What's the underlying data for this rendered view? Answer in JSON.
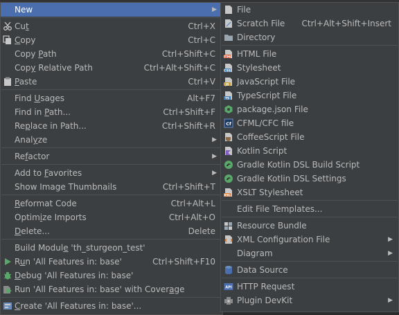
{
  "main_menu": [
    {
      "label": "New",
      "has_submenu": true,
      "selected": true
    },
    {
      "sep": true
    },
    {
      "label": "Cut",
      "shortcut": "Ctrl+X",
      "icon": "scissors-icon",
      "u": 2
    },
    {
      "label": "Copy",
      "shortcut": "Ctrl+C",
      "icon": "copy-icon",
      "u": 0
    },
    {
      "label": "Copy Path",
      "shortcut": "Ctrl+Shift+C",
      "u": 5
    },
    {
      "label": "Copy Relative Path",
      "shortcut": "Ctrl+Alt+Shift+C",
      "u": 3
    },
    {
      "label": "Paste",
      "shortcut": "Ctrl+V",
      "icon": "paste-icon",
      "u": 0
    },
    {
      "sep": true
    },
    {
      "label": "Find Usages",
      "shortcut": "Alt+F7",
      "u": 5
    },
    {
      "label": "Find in Path...",
      "shortcut": "Ctrl+Shift+F",
      "u": 8
    },
    {
      "label": "Replace in Path...",
      "shortcut": "Ctrl+Shift+R",
      "u": 2
    },
    {
      "label": "Analyze",
      "has_submenu": true,
      "u": 4
    },
    {
      "sep": true
    },
    {
      "label": "Refactor",
      "has_submenu": true,
      "u": 2
    },
    {
      "sep": true
    },
    {
      "label": "Add to Favorites",
      "has_submenu": true,
      "u": 7
    },
    {
      "label": "Show Image Thumbnails",
      "shortcut": "Ctrl+Shift+T"
    },
    {
      "sep": true
    },
    {
      "label": "Reformat Code",
      "shortcut": "Ctrl+Alt+L",
      "u": 0
    },
    {
      "label": "Optimize Imports",
      "shortcut": "Ctrl+Alt+O",
      "u": 5
    },
    {
      "label": "Delete...",
      "shortcut": "Delete",
      "u": 0
    },
    {
      "sep": true
    },
    {
      "label": "Build Module 'th_sturgeon_test'",
      "u": 11
    },
    {
      "label": "Run 'All Features in: base'",
      "shortcut": "Ctrl+Shift+F10",
      "icon": "run-icon",
      "u": 1
    },
    {
      "label": "Debug 'All Features in: base'",
      "icon": "debug-icon",
      "u": 0
    },
    {
      "label": "Run 'All Features in: base' with Coverage",
      "icon": "coverage-icon",
      "u": 38
    },
    {
      "sep": true
    },
    {
      "label": "Create 'All Features in: base'...",
      "icon": "create-config-icon",
      "u": 0
    }
  ],
  "sub_menu": [
    {
      "label": "File",
      "icon": "file-icon"
    },
    {
      "label": "Scratch File",
      "shortcut": "Ctrl+Alt+Shift+Insert",
      "icon": "scratch-file-icon"
    },
    {
      "label": "Directory",
      "icon": "folder-icon"
    },
    {
      "sep": true
    },
    {
      "label": "HTML File",
      "icon": "html-file-icon"
    },
    {
      "label": "Stylesheet",
      "icon": "css-file-icon"
    },
    {
      "label": "JavaScript File",
      "icon": "js-file-icon"
    },
    {
      "label": "TypeScript File",
      "icon": "ts-file-icon"
    },
    {
      "label": "package.json File",
      "icon": "npm-icon"
    },
    {
      "label": "CFML/CFC file",
      "icon": "cfml-icon"
    },
    {
      "label": "CoffeeScript File",
      "icon": "coffeescript-icon"
    },
    {
      "label": "Kotlin Script",
      "icon": "kotlin-icon"
    },
    {
      "label": "Gradle Kotlin DSL Build Script",
      "icon": "gradle-icon"
    },
    {
      "label": "Gradle Kotlin DSL Settings",
      "icon": "gradle-icon"
    },
    {
      "label": "XSLT Stylesheet",
      "icon": "xslt-icon"
    },
    {
      "sep": true
    },
    {
      "label": "Edit File Templates..."
    },
    {
      "sep": true
    },
    {
      "label": "Resource Bundle",
      "icon": "resource-bundle-icon"
    },
    {
      "label": "XML Configuration File",
      "has_submenu": true,
      "icon": "xml-icon"
    },
    {
      "label": "Diagram",
      "has_submenu": true
    },
    {
      "sep": true
    },
    {
      "label": "Data Source",
      "icon": "database-icon"
    },
    {
      "sep": true
    },
    {
      "label": "HTTP Request",
      "icon": "api-icon"
    },
    {
      "label": "Plugin DevKit",
      "has_submenu": true,
      "icon": "plugin-icon"
    }
  ],
  "colors": {
    "bg": "#3c3f41",
    "selected": "#4b6eaf",
    "text": "#bbbbbb",
    "separator": "#515151"
  }
}
